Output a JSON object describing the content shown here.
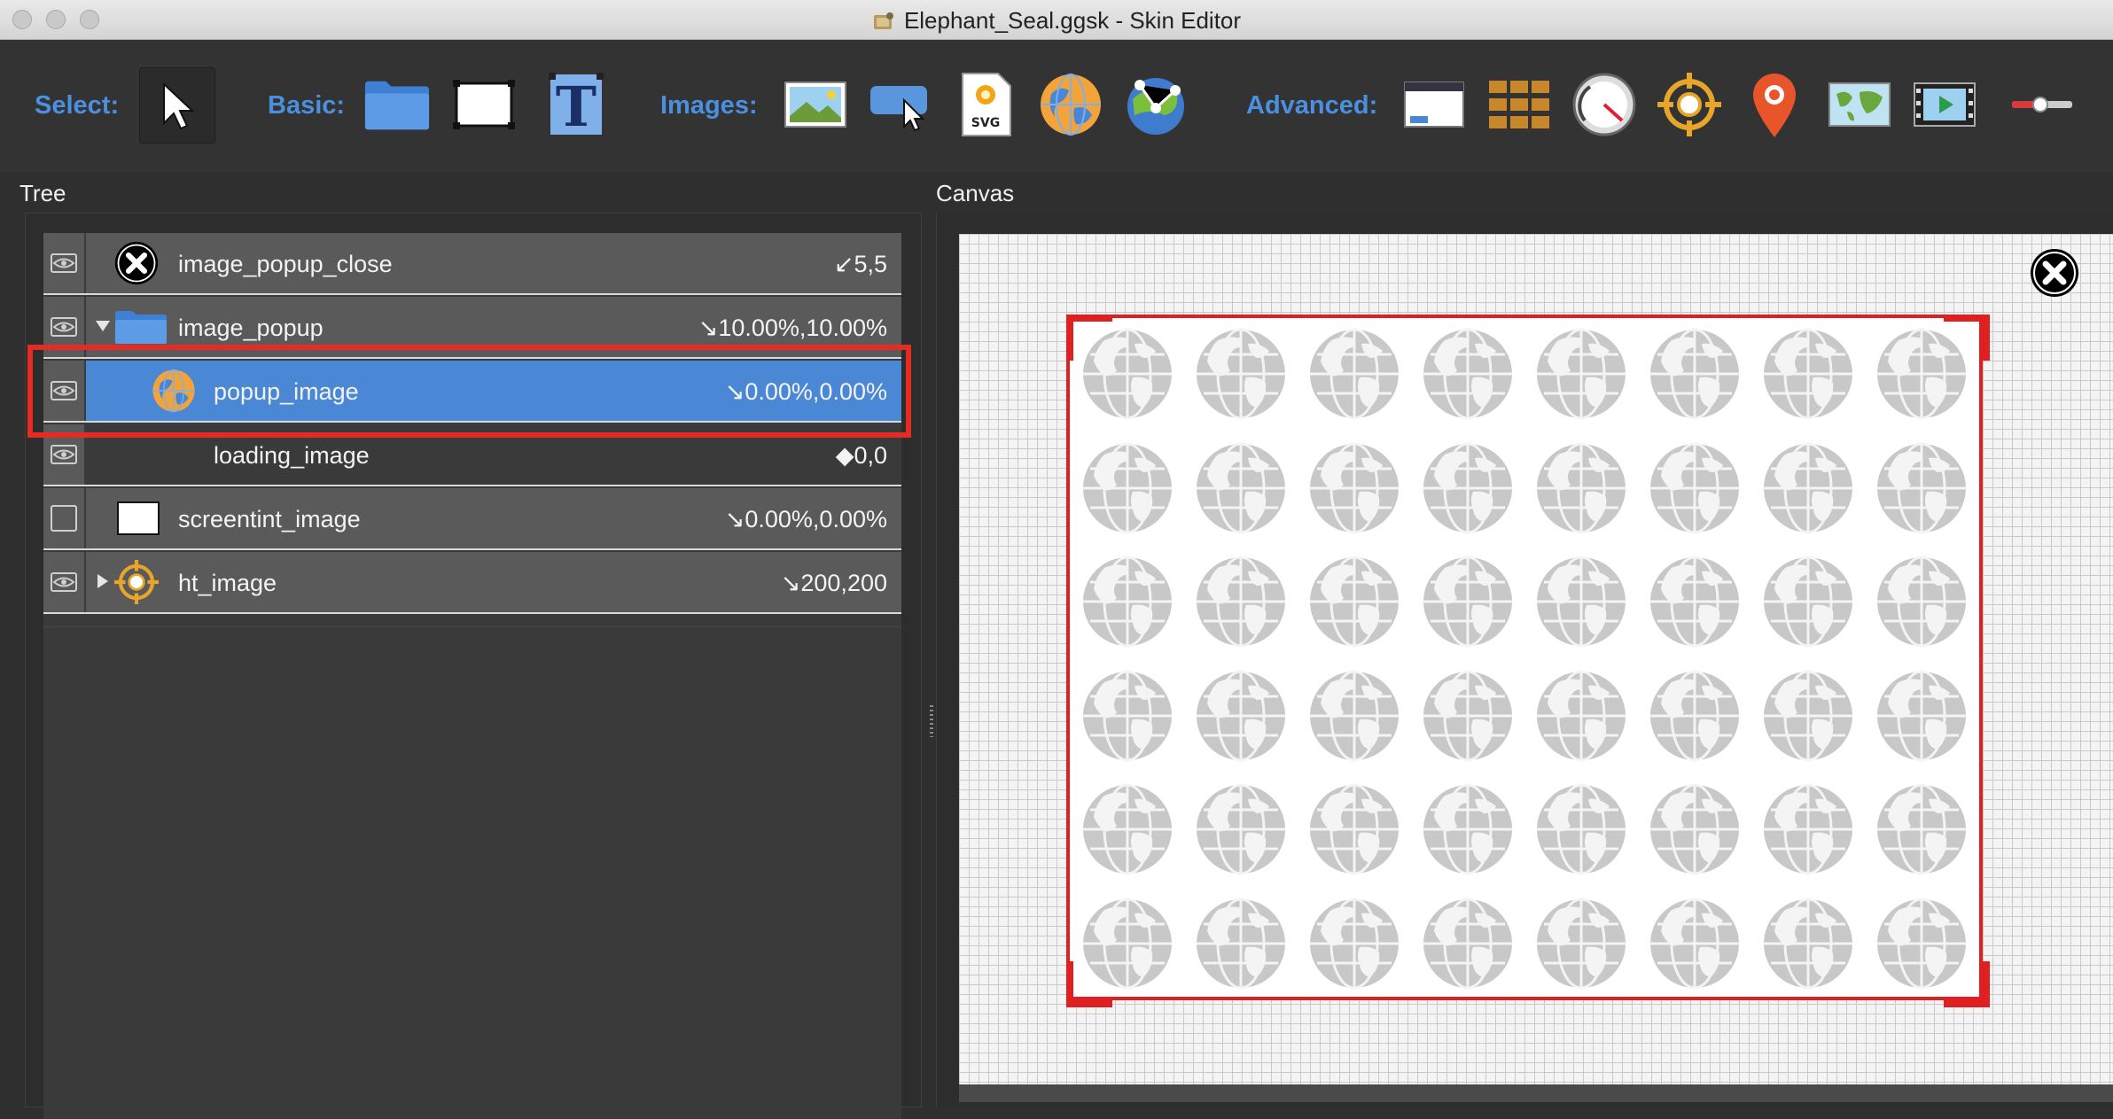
{
  "window": {
    "title": "Elephant_Seal.ggsk - Skin Editor"
  },
  "toolbar": {
    "select_label": "Select:",
    "basic_label": "Basic:",
    "images_label": "Images:",
    "advanced_label": "Advanced:",
    "svg_badge": "SVG",
    "text_glyph": "T",
    "buttons": {
      "select": "pointer-arrow-icon",
      "basic": [
        "container-folder-icon",
        "rectangle-icon",
        "text-icon"
      ],
      "images": [
        "image-icon",
        "button-cursor-icon",
        "svg-icon",
        "globe-panorama-icon",
        "cloner-globe-icon"
      ],
      "advanced": [
        "window-icon",
        "grid-cloner-icon",
        "dial-icon",
        "hotspot-target-icon",
        "map-pin-icon",
        "map-icon",
        "video-icon",
        "slider-icon"
      ]
    }
  },
  "panels": {
    "tree_title": "Tree",
    "canvas_title": "Canvas"
  },
  "tree": {
    "rows": [
      {
        "name": "image_popup_close",
        "value": "↙5,5",
        "visible": true,
        "icon": "close-icon"
      },
      {
        "name": "image_popup",
        "value": "↘10.00%,10.00%",
        "visible": true,
        "icon": "folder-icon",
        "expanded": true
      },
      {
        "name": "popup_image",
        "value": "↘0.00%,0.00%",
        "visible": true,
        "icon": "globe-image-icon",
        "selected": true
      },
      {
        "name": "loading_image",
        "value": "◆0,0",
        "visible": true,
        "icon": ""
      },
      {
        "name": "screentint_image",
        "value": "↘0.00%,0.00%",
        "visible": false,
        "icon": "rectangle-icon"
      },
      {
        "name": "ht_image",
        "value": "↘200,200",
        "visible": true,
        "icon": "hotspot-target-icon",
        "expanded": false
      }
    ]
  },
  "canvas": {
    "globe_rows": 6,
    "globe_cols": 8,
    "frame_color": "#e02020",
    "close_icon": "close-icon"
  },
  "colors": {
    "accent": "#4b8fe0",
    "selection": "#4a87d4",
    "highlight": "#e52b22"
  }
}
